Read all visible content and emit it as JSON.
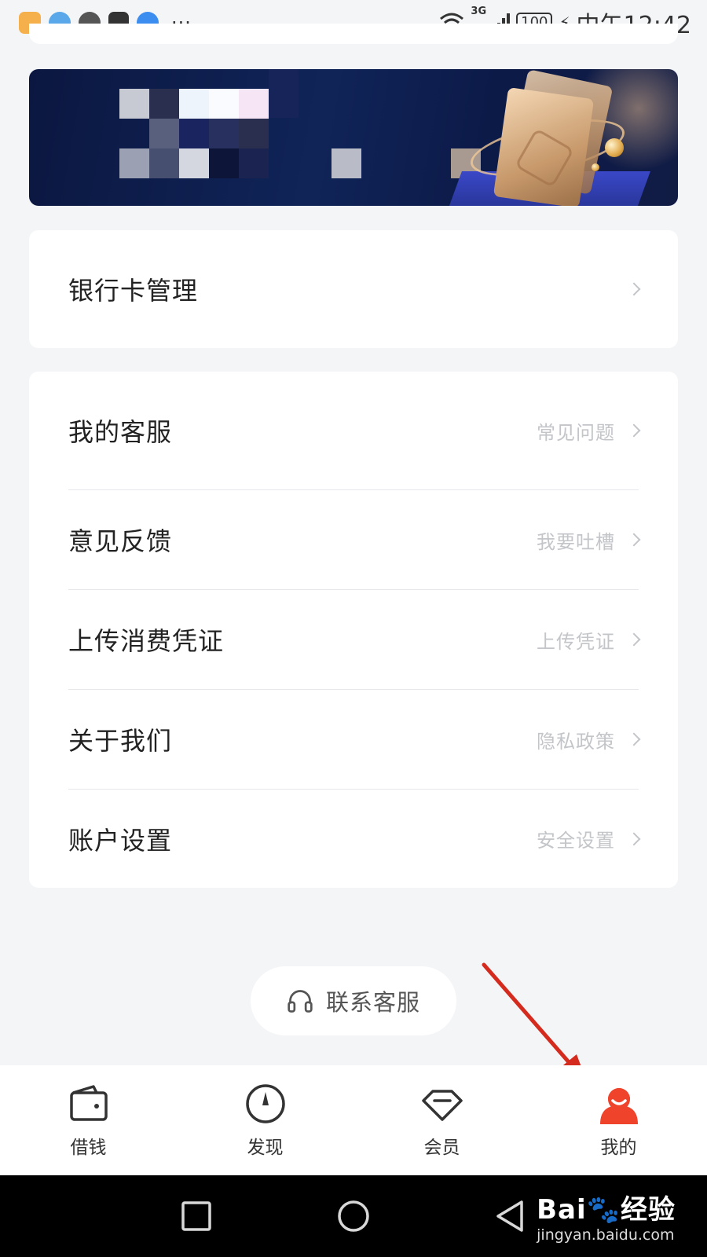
{
  "status_bar": {
    "notification_icons": [
      "orange-app-icon",
      "globe-icon",
      "shield-icon",
      "huawei-icon",
      "weather-icon"
    ],
    "overflow": "···",
    "network": "3G",
    "battery": "100",
    "time": "中午12:42"
  },
  "banner": {
    "image_description": "promo-banner"
  },
  "menu_bank": {
    "title": "银行卡管理"
  },
  "menu_items": [
    {
      "title": "我的客服",
      "sub": "常见问题"
    },
    {
      "title": "意见反馈",
      "sub": "我要吐槽"
    },
    {
      "title": "上传消费凭证",
      "sub": "上传凭证"
    },
    {
      "title": "关于我们",
      "sub": "隐私政策"
    },
    {
      "title": "账户设置",
      "sub": "安全设置"
    }
  ],
  "contact_button": {
    "label": "联系客服",
    "icon": "headset-icon"
  },
  "tabbar": {
    "tabs": [
      {
        "label": "借钱",
        "icon": "wallet-icon",
        "active": false
      },
      {
        "label": "发现",
        "icon": "compass-icon",
        "active": false
      },
      {
        "label": "会员",
        "icon": "diamond-icon",
        "active": false
      },
      {
        "label": "我的",
        "icon": "profile-icon",
        "active": true
      }
    ]
  },
  "watermark": {
    "brand": "Bai",
    "brand_suffix": "经验",
    "url": "jingyan.baidu.com"
  },
  "colors": {
    "accent": "#f0432c",
    "annotation_arrow": "#d42b1e",
    "background": "#f4f5f7"
  }
}
